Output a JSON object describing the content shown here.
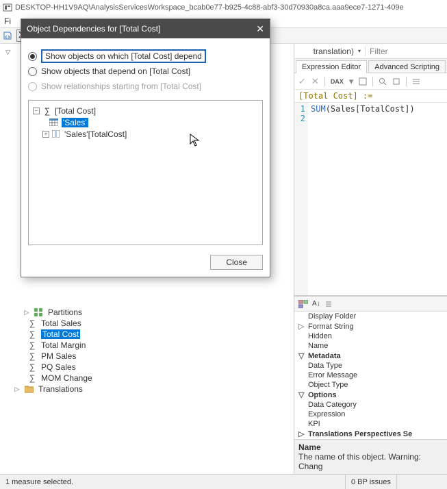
{
  "window": {
    "title": "DESKTOP-HH1V9AQ\\AnalysisServicesWorkspace_bcab0e77-b925-4c88-abf3-30d70930a8ca.aaa9ece7-1271-409e"
  },
  "menubar": {
    "file": "Fi"
  },
  "right": {
    "trans_select": "translation)",
    "filter_placeholder": "Filter",
    "tabs": {
      "expr": "Expression Editor",
      "adv": "Advanced Scripting"
    },
    "editor_toolbar": {
      "dax": "DAX"
    },
    "dax_title": "[Total Cost] :=",
    "code": {
      "line1": "",
      "line2_prefix": "SUM",
      "line2_rest": "(Sales[TotalCost])"
    },
    "props_items": {
      "display_folder": "Display Folder",
      "format_string": "Format String",
      "hidden": "Hidden",
      "name": "Name",
      "metadata": "Metadata",
      "data_type": "Data Type",
      "error_message": "Error Message",
      "object_type": "Object Type",
      "options": "Options",
      "data_category": "Data Category",
      "expression": "Expression",
      "kpi": "KPI",
      "translations": "Translations  Perspectives  Se"
    },
    "desc": {
      "title": "Name",
      "text": "The name of this object. Warning: Chang"
    }
  },
  "tree": {
    "partitions": "Partitions",
    "items": [
      "Total Sales",
      "Total Cost",
      "Total Margin",
      "PM Sales",
      "PQ Sales",
      "MOM Change"
    ],
    "translations": "Translations"
  },
  "dialog": {
    "title": "Object Dependencies for [Total Cost]",
    "radio1": "Show objects on which [Total Cost] depend",
    "radio2": "Show objects that depend on [Total Cost]",
    "radio3": "Show relationships starting from [Total Cost]",
    "tree": {
      "root": "[Total Cost]",
      "sales": "'Sales'",
      "col": "'Sales'[TotalCost]"
    },
    "close": "Close"
  },
  "status": {
    "left": "1 measure selected.",
    "right": "0 BP issues"
  }
}
